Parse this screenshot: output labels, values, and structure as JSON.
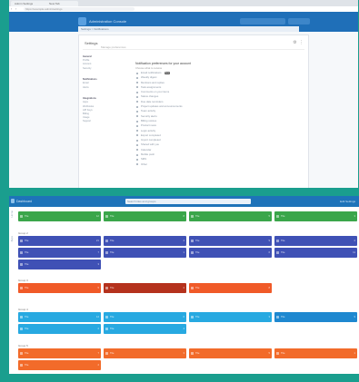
{
  "colors": {
    "frame": "#1a9e8e",
    "header_blue": "#1f6fb8",
    "green": "#3aa64a",
    "indigo": "#3f51b5",
    "orange": "#f05a28",
    "dark_red": "#b5321d",
    "sky": "#27a9e1",
    "sky_dark": "#1e88d0",
    "amber": "#f26b2a"
  },
  "top": {
    "browser_tabs": [
      "Admin Settings",
      "New Tab"
    ],
    "url": "https://example.admin/settings",
    "app_title": "Administration Console",
    "breadcrumb": "Settings > Notifications",
    "card_title": "Settings",
    "card_sub": "Manage preferences",
    "sidebar": [
      [
        "General",
        "Profile",
        "Account",
        "Security"
      ],
      [
        "Notifications",
        "Email",
        "Alerts"
      ],
      [
        "Integrations",
        "Apps",
        "Webhooks",
        "API Keys",
        "Billing",
        "Usage",
        "Support"
      ]
    ],
    "main_title": "Notification preferences for your account",
    "main_sub": "Choose what to receive",
    "options": [
      {
        "label": "Email notifications",
        "tag": "New"
      },
      {
        "label": "Weekly digest"
      },
      {
        "label": "Mentions and replies"
      },
      {
        "label": "Task assignments"
      },
      {
        "label": "Comments on your items"
      },
      {
        "label": "Status changes"
      },
      {
        "label": "Due date reminders"
      },
      {
        "label": "Project updates and announcements"
      },
      {
        "label": "Team activity"
      },
      {
        "label": "Security alerts"
      },
      {
        "label": "Billing notices"
      },
      {
        "label": "Product news"
      },
      {
        "label": "Login activity"
      },
      {
        "label": "Export completed"
      },
      {
        "label": "Import completed"
      },
      {
        "label": "Shared with you"
      },
      {
        "label": "Calendar"
      },
      {
        "label": "Mobile push"
      },
      {
        "label": "SMS"
      },
      {
        "label": "Other"
      }
    ]
  },
  "bottom": {
    "title": "Dashboard",
    "search_placeholder": "Search tiles and groups",
    "right_text": "Edit  Settings",
    "rail": [
      "Home",
      "Apps"
    ],
    "groups": [
      {
        "label": "Group 1",
        "color_key": "green",
        "tiles": [
          {
            "label": "Tile",
            "value": "12"
          },
          {
            "label": "Tile",
            "value": "8"
          },
          {
            "label": "Tile",
            "value": "5"
          },
          {
            "label": "Tile",
            "value": "3"
          }
        ]
      },
      {
        "label": "Group 2",
        "color_key": "indigo",
        "tiles": [
          {
            "label": "Tile",
            "value": "21"
          },
          {
            "label": "Tile",
            "value": "4"
          },
          {
            "label": "Tile",
            "value": "9"
          },
          {
            "label": "Tile",
            "value": "2"
          },
          {
            "label": "Tile",
            "value": "7"
          },
          {
            "label": "Tile",
            "value": "1"
          },
          {
            "label": "Tile",
            "value": "6"
          },
          {
            "label": "Tile",
            "value": "11"
          },
          {
            "label": "Tile",
            "value": "3"
          }
        ]
      },
      {
        "label": "Group 3",
        "color_key": "orange",
        "tiles": [
          {
            "label": "Tile",
            "value": "5"
          },
          {
            "label": "Tile",
            "value": "2",
            "dark": true
          },
          {
            "label": "Tile",
            "value": "8"
          }
        ]
      },
      {
        "label": "Group 4",
        "color_key": "sky",
        "tiles": [
          {
            "label": "Tile",
            "value": "14"
          },
          {
            "label": "Tile",
            "value": "6"
          },
          {
            "label": "Tile",
            "value": "3"
          },
          {
            "label": "Tile",
            "value": "9",
            "dark": true
          },
          {
            "label": "Tile",
            "value": "2"
          },
          {
            "label": "Tile",
            "value": "4"
          }
        ]
      },
      {
        "label": "Group 5",
        "color_key": "amber",
        "tiles": [
          {
            "label": "Tile",
            "value": "7"
          },
          {
            "label": "Tile",
            "value": "3"
          },
          {
            "label": "Tile",
            "value": "5"
          },
          {
            "label": "Tile",
            "value": "1"
          },
          {
            "label": "Tile",
            "value": "2"
          }
        ]
      }
    ]
  }
}
